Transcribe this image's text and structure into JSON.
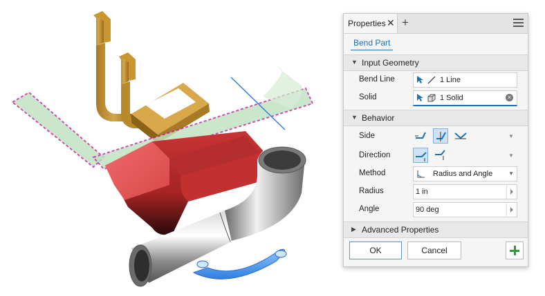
{
  "panel": {
    "tab_label": "Properties",
    "tab_close": "✕",
    "tab_add": "+",
    "feature_title": "Bend Part",
    "sections": {
      "input_geometry": "Input Geometry",
      "behavior": "Behavior",
      "advanced": "Advanced Properties"
    },
    "bend_line": {
      "label": "Bend Line",
      "value": "1 Line"
    },
    "solid": {
      "label": "Solid",
      "value": "1 Solid",
      "clear": "×"
    },
    "side": {
      "label": "Side",
      "options": [
        "side-1-icon",
        "side-2-icon",
        "symmetric-icon"
      ],
      "selected": 1
    },
    "direction": {
      "label": "Direction",
      "options": [
        "direction-flip-1-icon",
        "direction-flip-2-icon"
      ],
      "selected": 0
    },
    "method": {
      "label": "Method",
      "value": "Radius and Angle"
    },
    "radius": {
      "label": "Radius",
      "value": "1 in"
    },
    "angle": {
      "label": "Angle",
      "value": "90 deg"
    },
    "buttons": {
      "ok": "OK",
      "cancel": "Cancel"
    }
  },
  "colors": {
    "accent": "#1a73b8",
    "add_green": "#2e9a3c",
    "bracket": "#c89a38",
    "bent_block": "#c93434",
    "pipe": "#8a8a8a",
    "blue_part": "#3f8fe6",
    "preview_green": "#bfe2bf",
    "preview_outline": "#c020a0"
  }
}
